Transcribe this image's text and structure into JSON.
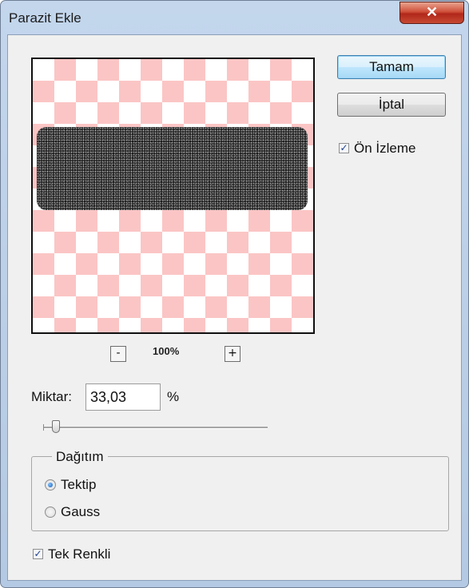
{
  "window": {
    "title": "Parazit Ekle",
    "close_glyph": "✕"
  },
  "preview": {
    "zoom_out_label": "-",
    "zoom_in_label": "+",
    "zoom_level": "100%"
  },
  "buttons": {
    "ok_label": "Tamam",
    "cancel_label": "İptal"
  },
  "preview_toggle": {
    "label": "Ön İzleme",
    "checked": true
  },
  "amount": {
    "label": "Miktar:",
    "value": "33,03",
    "unit": "%",
    "slider_fraction": 0.0825
  },
  "distribution": {
    "legend": "Dağıtım",
    "options": [
      {
        "label": "Tektip",
        "selected": true
      },
      {
        "label": "Gauss",
        "selected": false
      }
    ]
  },
  "monochrome": {
    "label": "Tek Renkli",
    "checked": true
  },
  "colors": {
    "checker_pink": "#fbc5c5",
    "noise_band": "#262626",
    "default_button": "#bee6fd",
    "close_button": "#c74a34"
  },
  "icons": {
    "close": "close-icon",
    "check": "checkmark-icon",
    "radio": "radio-dot-icon"
  }
}
